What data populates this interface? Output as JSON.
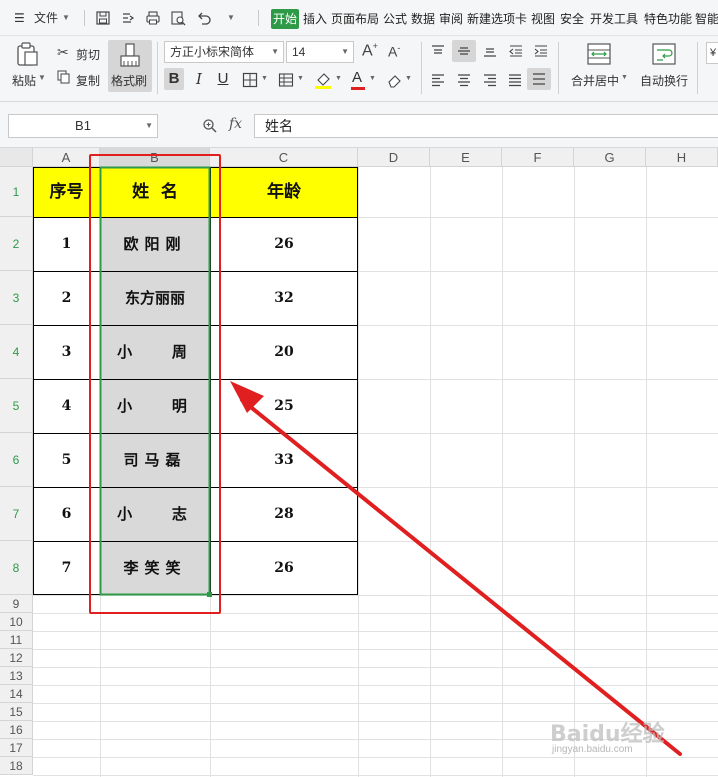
{
  "menu": {
    "file_label": "文件",
    "tabs": [
      "开始",
      "插入",
      "页面布局",
      "公式",
      "数据",
      "审阅",
      "新建选项卡",
      "视图",
      "安全",
      "开发工具",
      "特色功能",
      "智能"
    ]
  },
  "toolbar": {
    "paste_label": "粘贴",
    "cut_label": "剪切",
    "copy_label": "复制",
    "format_painter_label": "格式刷",
    "font_name": "方正小标宋简体",
    "font_size": "14",
    "merge_center_label": "合并居中",
    "wrap_text_label": "自动换行",
    "bold_active": true,
    "colors": {
      "accent": "#2e9a48",
      "highlight": "#ffff00",
      "font_color": "#e02020"
    }
  },
  "formula_bar": {
    "cell_ref": "B1",
    "fx_label": "fx",
    "content": "姓名"
  },
  "sheet": {
    "column_headers": [
      "A",
      "B",
      "C",
      "D",
      "E",
      "F",
      "G",
      "H"
    ],
    "row_headers": [
      "1",
      "2",
      "3",
      "4",
      "5",
      "6",
      "7",
      "8",
      "9",
      "10",
      "11",
      "12",
      "13",
      "14",
      "15",
      "16",
      "17",
      "18"
    ],
    "table_header": {
      "index": "序号",
      "name": "姓  名",
      "age": "年龄"
    },
    "rows": [
      {
        "index": "1",
        "name": "欧阳刚",
        "age": "26"
      },
      {
        "index": "2",
        "name": "东方丽丽",
        "age": "32"
      },
      {
        "index": "3",
        "name": "小   周",
        "age": "20"
      },
      {
        "index": "4",
        "name": "小   明",
        "age": "25"
      },
      {
        "index": "5",
        "name": "司马磊",
        "age": "33"
      },
      {
        "index": "6",
        "name": "小   志",
        "age": "28"
      },
      {
        "index": "7",
        "name": "李笑笑",
        "age": "26"
      }
    ],
    "selected_column": "B",
    "header_fill": "#ffff00"
  },
  "annotation": {
    "color": "#e02020"
  },
  "watermark": {
    "text": "Baidu经验",
    "subtext": "jingyan.baidu.com"
  }
}
